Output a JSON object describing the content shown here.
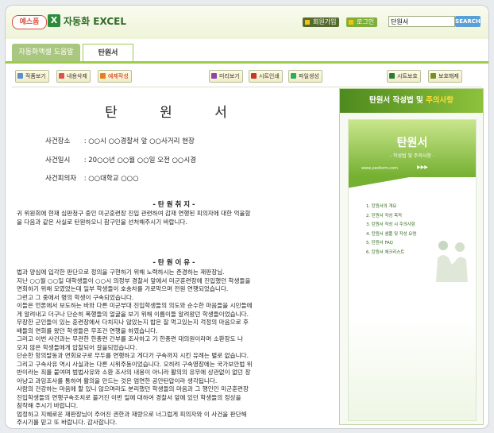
{
  "header": {
    "logo_badge": "예스폼",
    "excel_icon": "X",
    "logo_text": "자동화 EXCEL",
    "btn_member": "회원가입",
    "btn_login": "로그인",
    "search_value": "단원서",
    "search_button": "SEARCH"
  },
  "tabs": [
    {
      "label": "자동화엑셀 도움말"
    },
    {
      "label": "탄원서"
    }
  ],
  "toolbar": {
    "btn1": "작품보기",
    "btn2": "내용삭제",
    "btn3": "예제작성",
    "btn4": "미리보기",
    "btn5": "시트인쇄",
    "btn6": "파일생성",
    "btn7": "시트보호",
    "btn8": "보호해제"
  },
  "doc": {
    "title": "탄 원 서",
    "fields": [
      {
        "label": "사건장소",
        "value": ": ○○시 ○○경찰서 앞 ○○사거리 현장"
      },
      {
        "label": "사건일시",
        "value": ": 20○○년 ○○월 ○○일 오전 ○○시경"
      },
      {
        "label": "사건피의자",
        "value": ": ○○대학교 ○○○"
      }
    ],
    "section1_title": "- 탄 원 취 지 -",
    "section1_lines": [
      "귀 위원회에 현재 심판청구 중인 미군훈련장 진입 관련하여 감재 연행된 피의자에 대한 억울함",
      "을 다음과 같은 사실로 탄원하오니 참구민을 선처해주시기 바랍니다."
    ],
    "section2_title": "- 탄 원 이 유 -",
    "section2_lines": [
      "법과 양심에 입각한 판단으로 정의을 구현하기 위해 노력하시는 존경하는 재판장님.",
      "지난 ○○월 ○○일 대학생들이 ○○시 의정부 경찰서 앞에서 미군훈련장에 진입했던 학생들을",
      "면회하기 위해 모였었는데 일부 학생들이 호송차를 가로막으며 전원 연행되었습니다.",
      "그런고 그 중에서    명의 학생이 구속되었습니다.",
      "이들은 언론에서 보도하는 바와 다른 미군부대 진입학생들의 의도와 순수한 마음들을 시민들에",
      "게 알려내고 더구나 단순히 폭행들의 얼굴을 보기 위해 이름이들 알려왔던 학생들이었습니다.",
      "무장한 군인들이 있는 훈련장에서 다치지나 않았는지 밥은 잘 먹고있는지 걱정의 마음으로 후",
      "배들의 면회를 왔던 학생들은 무조건 연행을 하였습니다.",
      "그러고 이번 사건과는 무관한 한총련 간부를 조사하고    기 한총련 대의원이라며 소환장도 나",
      "오지 않은 학생들에게 압찰되어 갈을되었습니다.",
      "단순한 항의발동과 면회요구로 무두를 연행하고 게다가 구속까지 시킨 유례는 별로 없습니다.",
      "그리고 구속사유 역시 사실과는 다른 시위주동이었습니다. 오히려 구속영장에는 국가보안법 위",
      "반이라는 죄를 붙여며 범법사유와 소환 조사의 내용이 아니라 활의의 유무에 상관없이 없던 장",
      "아냥고 과잉조사를 통하여 활의을 만드는 것은 엄연한 공안탄압이라 생각됩니다.",
      "사람의 건강하는 마음에 할 있니 않으며라도 분리했던 학생들의 마음과 그 행인인 미군훈련장",
      "진입학생들의 연행구속조치로 불거진 이번 일에 대하여    경찰서 앞에 있던 학생들의 정상을",
      "참작해 주시기 바랍니다.",
      "엄정하고 지혜로운 재판장님이 주어진 권한과 재량으로 너그럽게 피의자와 이 사건을 판단해",
      "주시기를 믿고 또 바랍니다. 감사합니다."
    ]
  },
  "side": {
    "header_prefix": "탄원서 작성법 및",
    "header_highlight": "주의사항",
    "cover_title": "탄원서",
    "cover_subtitle": "- 작성법 및 주의사항 -",
    "cover_url": "www.yesform.com",
    "cover_arrows": "▶▶▶",
    "toc": [
      "1. 탄원서의 개요",
      "2. 탄원서 작성 목적",
      "3. 탄원서 작성 시 주의사항",
      "4. 탄원서 샘플 및 작성 요령",
      "5. 탄원서 FAQ",
      "6. 탄원서 체크리스트"
    ]
  },
  "colors": {
    "brand_green": "#6fa82b",
    "accent_yellow": "#ffdd33",
    "logo_red": "#d94b3a"
  }
}
